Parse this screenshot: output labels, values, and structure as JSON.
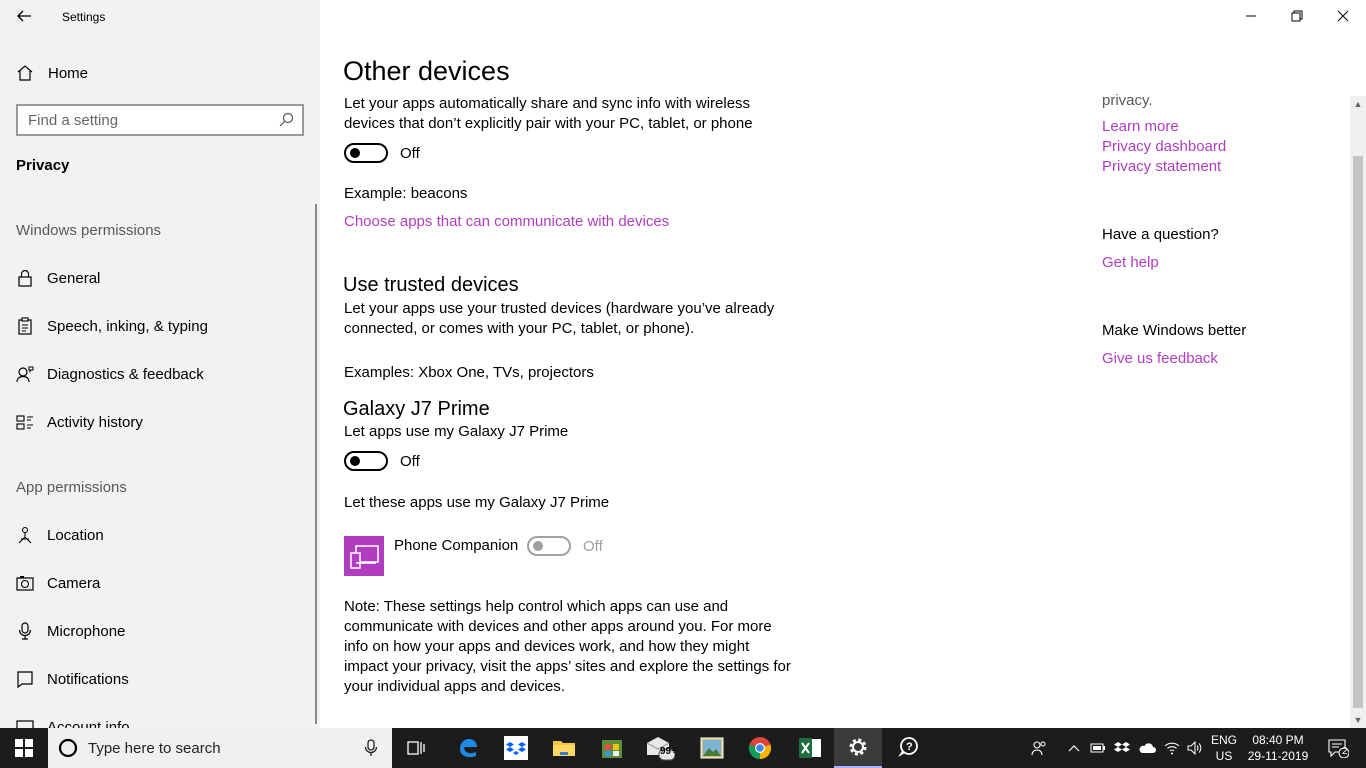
{
  "window": {
    "title": "Settings"
  },
  "sidebar": {
    "home_label": "Home",
    "search_placeholder": "Find a setting",
    "current_section": "Privacy",
    "windows_permissions_header": "Windows permissions",
    "windows_permissions": [
      {
        "label": "General",
        "icon": "lock-icon"
      },
      {
        "label": "Speech, inking, & typing",
        "icon": "clipboard-icon"
      },
      {
        "label": "Diagnostics & feedback",
        "icon": "person-feedback-icon"
      },
      {
        "label": "Activity history",
        "icon": "activity-history-icon"
      }
    ],
    "app_permissions_header": "App permissions",
    "app_permissions": [
      {
        "label": "Location",
        "icon": "location-icon"
      },
      {
        "label": "Camera",
        "icon": "camera-icon"
      },
      {
        "label": "Microphone",
        "icon": "microphone-icon"
      },
      {
        "label": "Notifications",
        "icon": "notification-icon"
      },
      {
        "label": "Account info",
        "icon": "account-info-icon"
      }
    ]
  },
  "main": {
    "title": "Other devices",
    "other_devices_desc_1": "Let your apps automatically share and sync info with wireless",
    "other_devices_desc_2": "devices that don’t explicitly pair with your PC, tablet, or phone",
    "other_devices_toggle": "Off",
    "example_beacons": "Example: beacons",
    "choose_apps_link": "Choose apps that can communicate with devices",
    "trusted_title": "Use trusted devices",
    "trusted_desc_1": "Let your apps use your trusted devices (hardware you’ve already",
    "trusted_desc_2": "connected, or comes with your PC, tablet, or phone).",
    "trusted_examples": "Examples: Xbox One, TVs, projectors",
    "device_name": "Galaxy J7 Prime",
    "device_desc": "Let apps use my Galaxy J7 Prime",
    "device_toggle": "Off",
    "apps_list_header": "Let these apps use my Galaxy J7 Prime",
    "app_name": "Phone Companion",
    "app_toggle": "Off",
    "note_1": "Note: These settings help control which apps can use and",
    "note_2": "communicate with devices and other apps around you. For more",
    "note_3": "info on how your apps and devices work, and how they might",
    "note_4": "impact your privacy, visit the apps’ sites and explore the settings for",
    "note_5": "your individual apps and devices."
  },
  "right_panel": {
    "privacy_tail": "privacy.",
    "learn_more": "Learn more",
    "privacy_dashboard": "Privacy dashboard",
    "privacy_statement": "Privacy statement",
    "question_header": "Have a question?",
    "get_help": "Get help",
    "better_header": "Make Windows better",
    "feedback": "Give us feedback"
  },
  "taskbar": {
    "search_placeholder": "Type here to search",
    "mail_badge": "99+",
    "lang_1": "ENG",
    "lang_2": "US",
    "time": "08:40 PM",
    "date": "29-11-2019",
    "notification_count": "2"
  },
  "colors": {
    "accent_link": "#b03dc0",
    "taskbar": "#1c1c1c",
    "sidebar": "#f2f2f2"
  }
}
